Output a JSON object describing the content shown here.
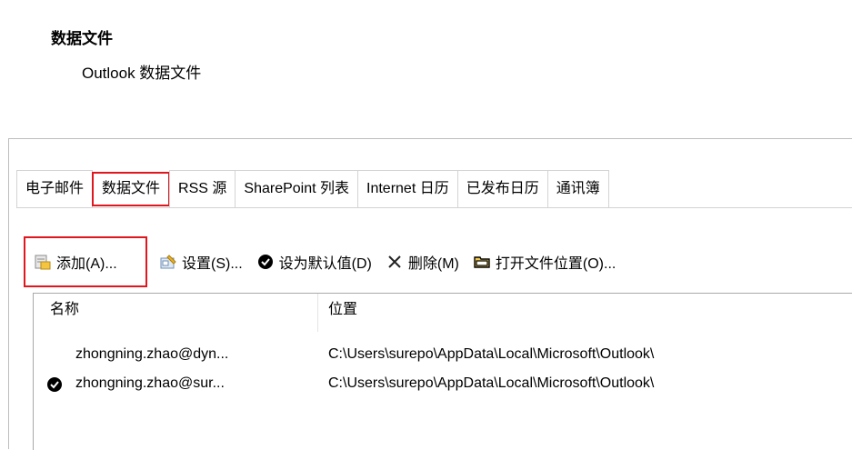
{
  "header": {
    "title": "数据文件",
    "subtitle": "Outlook 数据文件"
  },
  "tabs": [
    {
      "label": "电子邮件",
      "active": false
    },
    {
      "label": "数据文件",
      "active": true
    },
    {
      "label": "RSS 源",
      "active": false
    },
    {
      "label": "SharePoint 列表",
      "active": false
    },
    {
      "label": "Internet 日历",
      "active": false
    },
    {
      "label": "已发布日历",
      "active": false
    },
    {
      "label": "通讯簿",
      "active": false
    }
  ],
  "toolbar": {
    "add_label": "添加(A)...",
    "settings_label": "设置(S)...",
    "default_label": "设为默认值(D)",
    "delete_label": "删除(M)",
    "open_location_label": "打开文件位置(O)..."
  },
  "list": {
    "columns": [
      "名称",
      "位置"
    ],
    "rows": [
      {
        "name": "zhongning.zhao@dyn...",
        "location": "C:\\Users\\surepo\\AppData\\Local\\Microsoft\\Outlook\\",
        "default": false
      },
      {
        "name": "zhongning.zhao@sur...",
        "location": "C:\\Users\\surepo\\AppData\\Local\\Microsoft\\Outlook\\",
        "default": true
      }
    ]
  },
  "colors": {
    "highlight": "#e0171e",
    "border": "#d3d3d3"
  }
}
